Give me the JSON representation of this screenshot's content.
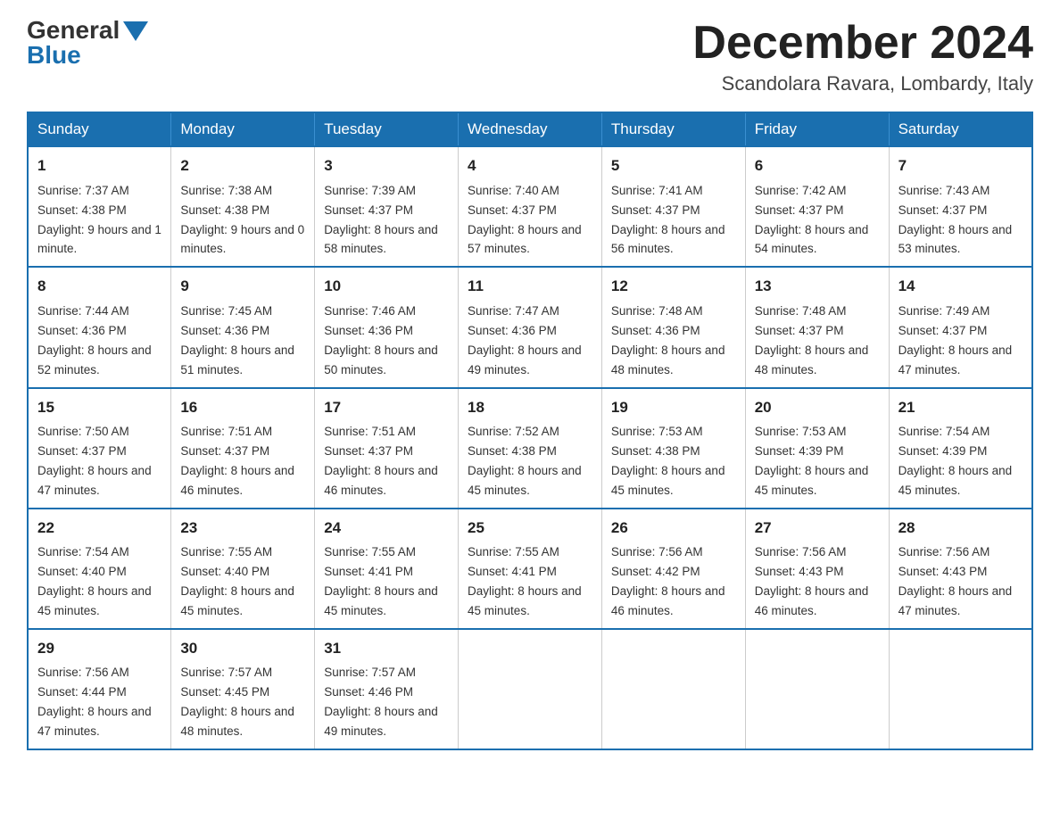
{
  "logo": {
    "general": "General",
    "blue": "Blue"
  },
  "header": {
    "month": "December 2024",
    "location": "Scandolara Ravara, Lombardy, Italy"
  },
  "days_of_week": [
    "Sunday",
    "Monday",
    "Tuesday",
    "Wednesday",
    "Thursday",
    "Friday",
    "Saturday"
  ],
  "weeks": [
    [
      {
        "day": "1",
        "sunrise": "7:37 AM",
        "sunset": "4:38 PM",
        "daylight": "9 hours and 1 minute."
      },
      {
        "day": "2",
        "sunrise": "7:38 AM",
        "sunset": "4:38 PM",
        "daylight": "9 hours and 0 minutes."
      },
      {
        "day": "3",
        "sunrise": "7:39 AM",
        "sunset": "4:37 PM",
        "daylight": "8 hours and 58 minutes."
      },
      {
        "day": "4",
        "sunrise": "7:40 AM",
        "sunset": "4:37 PM",
        "daylight": "8 hours and 57 minutes."
      },
      {
        "day": "5",
        "sunrise": "7:41 AM",
        "sunset": "4:37 PM",
        "daylight": "8 hours and 56 minutes."
      },
      {
        "day": "6",
        "sunrise": "7:42 AM",
        "sunset": "4:37 PM",
        "daylight": "8 hours and 54 minutes."
      },
      {
        "day": "7",
        "sunrise": "7:43 AM",
        "sunset": "4:37 PM",
        "daylight": "8 hours and 53 minutes."
      }
    ],
    [
      {
        "day": "8",
        "sunrise": "7:44 AM",
        "sunset": "4:36 PM",
        "daylight": "8 hours and 52 minutes."
      },
      {
        "day": "9",
        "sunrise": "7:45 AM",
        "sunset": "4:36 PM",
        "daylight": "8 hours and 51 minutes."
      },
      {
        "day": "10",
        "sunrise": "7:46 AM",
        "sunset": "4:36 PM",
        "daylight": "8 hours and 50 minutes."
      },
      {
        "day": "11",
        "sunrise": "7:47 AM",
        "sunset": "4:36 PM",
        "daylight": "8 hours and 49 minutes."
      },
      {
        "day": "12",
        "sunrise": "7:48 AM",
        "sunset": "4:36 PM",
        "daylight": "8 hours and 48 minutes."
      },
      {
        "day": "13",
        "sunrise": "7:48 AM",
        "sunset": "4:37 PM",
        "daylight": "8 hours and 48 minutes."
      },
      {
        "day": "14",
        "sunrise": "7:49 AM",
        "sunset": "4:37 PM",
        "daylight": "8 hours and 47 minutes."
      }
    ],
    [
      {
        "day": "15",
        "sunrise": "7:50 AM",
        "sunset": "4:37 PM",
        "daylight": "8 hours and 47 minutes."
      },
      {
        "day": "16",
        "sunrise": "7:51 AM",
        "sunset": "4:37 PM",
        "daylight": "8 hours and 46 minutes."
      },
      {
        "day": "17",
        "sunrise": "7:51 AM",
        "sunset": "4:37 PM",
        "daylight": "8 hours and 46 minutes."
      },
      {
        "day": "18",
        "sunrise": "7:52 AM",
        "sunset": "4:38 PM",
        "daylight": "8 hours and 45 minutes."
      },
      {
        "day": "19",
        "sunrise": "7:53 AM",
        "sunset": "4:38 PM",
        "daylight": "8 hours and 45 minutes."
      },
      {
        "day": "20",
        "sunrise": "7:53 AM",
        "sunset": "4:39 PM",
        "daylight": "8 hours and 45 minutes."
      },
      {
        "day": "21",
        "sunrise": "7:54 AM",
        "sunset": "4:39 PM",
        "daylight": "8 hours and 45 minutes."
      }
    ],
    [
      {
        "day": "22",
        "sunrise": "7:54 AM",
        "sunset": "4:40 PM",
        "daylight": "8 hours and 45 minutes."
      },
      {
        "day": "23",
        "sunrise": "7:55 AM",
        "sunset": "4:40 PM",
        "daylight": "8 hours and 45 minutes."
      },
      {
        "day": "24",
        "sunrise": "7:55 AM",
        "sunset": "4:41 PM",
        "daylight": "8 hours and 45 minutes."
      },
      {
        "day": "25",
        "sunrise": "7:55 AM",
        "sunset": "4:41 PM",
        "daylight": "8 hours and 45 minutes."
      },
      {
        "day": "26",
        "sunrise": "7:56 AM",
        "sunset": "4:42 PM",
        "daylight": "8 hours and 46 minutes."
      },
      {
        "day": "27",
        "sunrise": "7:56 AM",
        "sunset": "4:43 PM",
        "daylight": "8 hours and 46 minutes."
      },
      {
        "day": "28",
        "sunrise": "7:56 AM",
        "sunset": "4:43 PM",
        "daylight": "8 hours and 47 minutes."
      }
    ],
    [
      {
        "day": "29",
        "sunrise": "7:56 AM",
        "sunset": "4:44 PM",
        "daylight": "8 hours and 47 minutes."
      },
      {
        "day": "30",
        "sunrise": "7:57 AM",
        "sunset": "4:45 PM",
        "daylight": "8 hours and 48 minutes."
      },
      {
        "day": "31",
        "sunrise": "7:57 AM",
        "sunset": "4:46 PM",
        "daylight": "8 hours and 49 minutes."
      },
      null,
      null,
      null,
      null
    ]
  ]
}
